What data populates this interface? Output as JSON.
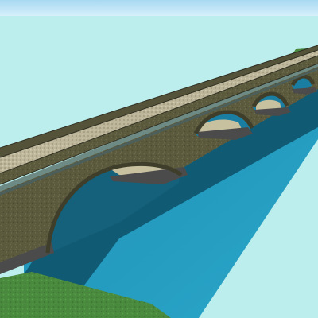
{
  "scene": {
    "subject": "stone-arch-bridge-3d-model",
    "arch_count": 5,
    "colors": {
      "sky": "#bfeff0",
      "sky_top": "#a9d8f2",
      "water_light": "#2aa9c9",
      "water_dark": "#0f5670",
      "stone": "#5a5a3c",
      "stone_shadow": "#3e3e2b",
      "deck": "#b9b296",
      "grass": "#4c8a3f",
      "pier_base": "#4f4f4f"
    }
  }
}
